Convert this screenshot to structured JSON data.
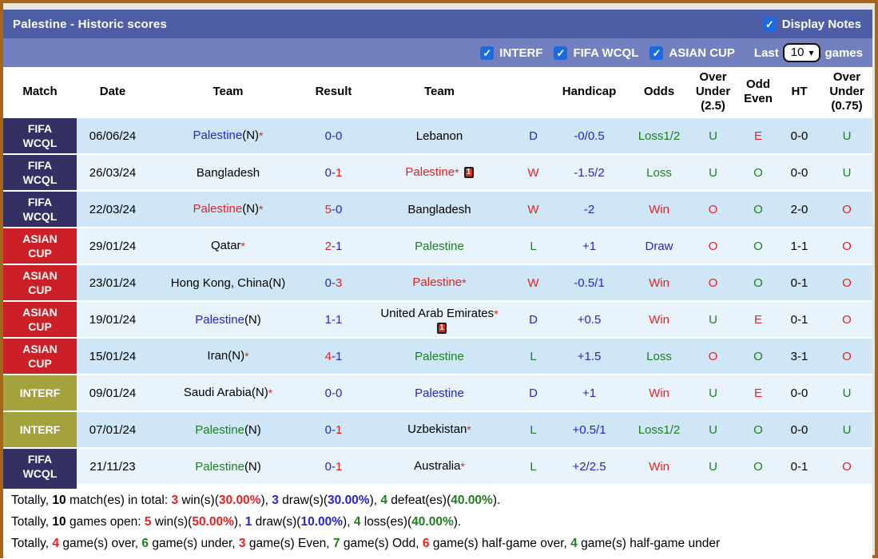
{
  "header": {
    "title": "Palestine - Historic scores",
    "display_notes_label": "Display Notes"
  },
  "filter_bar": {
    "checkboxes": [
      {
        "label": "INTERF",
        "checked": true
      },
      {
        "label": "FIFA WCQL",
        "checked": true
      },
      {
        "label": "ASIAN CUP",
        "checked": true
      }
    ],
    "last_label": "Last",
    "last_value": "10",
    "games_label": "games"
  },
  "table": {
    "columns": [
      "Match",
      "Date",
      "Team",
      "Result",
      "Team",
      "",
      "Handicap",
      "Odds",
      "Over Under (2.5)",
      "Odd Even",
      "HT",
      "Over Under (0.75)"
    ],
    "rows": [
      {
        "comp": "FIFA WCQL",
        "comp_key": "fifa",
        "date": "06/06/24",
        "home": {
          "name": "Palestine",
          "suffix": "(N)",
          "star": true,
          "color": "blue",
          "card": ""
        },
        "result": {
          "h": "0",
          "a": "0",
          "hc": "blue",
          "ac": "blue"
        },
        "away": {
          "name": "Lebanon",
          "suffix": "",
          "star": false,
          "color": "black",
          "card": ""
        },
        "wdl": {
          "t": "D",
          "c": "blue"
        },
        "handicap": "-0/0.5",
        "odds": {
          "t": "Loss1/2",
          "c": "green"
        },
        "ou25": {
          "t": "U",
          "c": "green"
        },
        "oddeven": {
          "t": "E",
          "c": "red"
        },
        "ht": "0-0",
        "ou075": {
          "t": "U",
          "c": "green"
        }
      },
      {
        "comp": "FIFA WCQL",
        "comp_key": "fifa",
        "date": "26/03/24",
        "home": {
          "name": "Bangladesh",
          "suffix": "",
          "star": false,
          "color": "black",
          "card": ""
        },
        "result": {
          "h": "0",
          "a": "1",
          "hc": "blue",
          "ac": "red"
        },
        "away": {
          "name": "Palestine",
          "suffix": "",
          "star": true,
          "color": "red",
          "card": "inline"
        },
        "wdl": {
          "t": "W",
          "c": "red"
        },
        "handicap": "-1.5/2",
        "odds": {
          "t": "Loss",
          "c": "green"
        },
        "ou25": {
          "t": "U",
          "c": "green"
        },
        "oddeven": {
          "t": "O",
          "c": "green"
        },
        "ht": "0-0",
        "ou075": {
          "t": "U",
          "c": "green"
        }
      },
      {
        "comp": "FIFA WCQL",
        "comp_key": "fifa",
        "date": "22/03/24",
        "home": {
          "name": "Palestine",
          "suffix": "(N)",
          "star": true,
          "color": "red",
          "card": ""
        },
        "result": {
          "h": "5",
          "a": "0",
          "hc": "red",
          "ac": "blue"
        },
        "away": {
          "name": "Bangladesh",
          "suffix": "",
          "star": false,
          "color": "black",
          "card": ""
        },
        "wdl": {
          "t": "W",
          "c": "red"
        },
        "handicap": "-2",
        "odds": {
          "t": "Win",
          "c": "red"
        },
        "ou25": {
          "t": "O",
          "c": "red"
        },
        "oddeven": {
          "t": "O",
          "c": "green"
        },
        "ht": "2-0",
        "ou075": {
          "t": "O",
          "c": "red"
        }
      },
      {
        "comp": "ASIAN CUP",
        "comp_key": "asian",
        "date": "29/01/24",
        "home": {
          "name": "Qatar",
          "suffix": "",
          "star": true,
          "color": "black",
          "card": ""
        },
        "result": {
          "h": "2",
          "a": "1",
          "hc": "red",
          "ac": "blue"
        },
        "away": {
          "name": "Palestine",
          "suffix": "",
          "star": false,
          "color": "green",
          "card": ""
        },
        "wdl": {
          "t": "L",
          "c": "green"
        },
        "handicap": "+1",
        "odds": {
          "t": "Draw",
          "c": "blue"
        },
        "ou25": {
          "t": "O",
          "c": "red"
        },
        "oddeven": {
          "t": "O",
          "c": "green"
        },
        "ht": "1-1",
        "ou075": {
          "t": "O",
          "c": "red"
        }
      },
      {
        "comp": "ASIAN CUP",
        "comp_key": "asian",
        "date": "23/01/24",
        "home": {
          "name": "Hong Kong, China",
          "suffix": "(N)",
          "star": false,
          "color": "black",
          "card": ""
        },
        "result": {
          "h": "0",
          "a": "3",
          "hc": "blue",
          "ac": "red"
        },
        "away": {
          "name": "Palestine",
          "suffix": "",
          "star": true,
          "color": "red",
          "card": ""
        },
        "wdl": {
          "t": "W",
          "c": "red"
        },
        "handicap": "-0.5/1",
        "odds": {
          "t": "Win",
          "c": "red"
        },
        "ou25": {
          "t": "O",
          "c": "red"
        },
        "oddeven": {
          "t": "O",
          "c": "green"
        },
        "ht": "0-1",
        "ou075": {
          "t": "O",
          "c": "red"
        }
      },
      {
        "comp": "ASIAN CUP",
        "comp_key": "asian",
        "date": "19/01/24",
        "home": {
          "name": "Palestine",
          "suffix": "(N)",
          "star": false,
          "color": "blue",
          "card": ""
        },
        "result": {
          "h": "1",
          "a": "1",
          "hc": "blue",
          "ac": "blue"
        },
        "away": {
          "name": "United Arab Emirates",
          "suffix": "",
          "star": true,
          "color": "black",
          "card": "below"
        },
        "wdl": {
          "t": "D",
          "c": "blue"
        },
        "handicap": "+0.5",
        "odds": {
          "t": "Win",
          "c": "red"
        },
        "ou25": {
          "t": "U",
          "c": "green"
        },
        "oddeven": {
          "t": "E",
          "c": "red"
        },
        "ht": "0-1",
        "ou075": {
          "t": "O",
          "c": "red"
        }
      },
      {
        "comp": "ASIAN CUP",
        "comp_key": "asian",
        "date": "15/01/24",
        "home": {
          "name": "Iran",
          "suffix": "(N)",
          "star": true,
          "color": "black",
          "card": ""
        },
        "result": {
          "h": "4",
          "a": "1",
          "hc": "red",
          "ac": "blue"
        },
        "away": {
          "name": "Palestine",
          "suffix": "",
          "star": false,
          "color": "green",
          "card": ""
        },
        "wdl": {
          "t": "L",
          "c": "green"
        },
        "handicap": "+1.5",
        "odds": {
          "t": "Loss",
          "c": "green"
        },
        "ou25": {
          "t": "O",
          "c": "red"
        },
        "oddeven": {
          "t": "O",
          "c": "green"
        },
        "ht": "3-1",
        "ou075": {
          "t": "O",
          "c": "red"
        }
      },
      {
        "comp": "INTERF",
        "comp_key": "interf",
        "date": "09/01/24",
        "home": {
          "name": "Saudi Arabia",
          "suffix": "(N)",
          "star": true,
          "color": "black",
          "card": ""
        },
        "result": {
          "h": "0",
          "a": "0",
          "hc": "blue",
          "ac": "blue"
        },
        "away": {
          "name": "Palestine",
          "suffix": "",
          "star": false,
          "color": "blue",
          "card": ""
        },
        "wdl": {
          "t": "D",
          "c": "blue"
        },
        "handicap": "+1",
        "odds": {
          "t": "Win",
          "c": "red"
        },
        "ou25": {
          "t": "U",
          "c": "green"
        },
        "oddeven": {
          "t": "E",
          "c": "red"
        },
        "ht": "0-0",
        "ou075": {
          "t": "U",
          "c": "green"
        }
      },
      {
        "comp": "INTERF",
        "comp_key": "interf",
        "date": "07/01/24",
        "home": {
          "name": "Palestine",
          "suffix": "(N)",
          "star": false,
          "color": "green",
          "card": ""
        },
        "result": {
          "h": "0",
          "a": "1",
          "hc": "blue",
          "ac": "red"
        },
        "away": {
          "name": "Uzbekistan",
          "suffix": "",
          "star": true,
          "color": "black",
          "card": ""
        },
        "wdl": {
          "t": "L",
          "c": "green"
        },
        "handicap": "+0.5/1",
        "odds": {
          "t": "Loss1/2",
          "c": "green"
        },
        "ou25": {
          "t": "U",
          "c": "green"
        },
        "oddeven": {
          "t": "O",
          "c": "green"
        },
        "ht": "0-0",
        "ou075": {
          "t": "U",
          "c": "green"
        }
      },
      {
        "comp": "FIFA WCQL",
        "comp_key": "fifa",
        "date": "21/11/23",
        "home": {
          "name": "Palestine",
          "suffix": "(N)",
          "star": false,
          "color": "green",
          "card": ""
        },
        "result": {
          "h": "0",
          "a": "1",
          "hc": "blue",
          "ac": "red"
        },
        "away": {
          "name": "Australia",
          "suffix": "",
          "star": true,
          "color": "black",
          "card": ""
        },
        "wdl": {
          "t": "L",
          "c": "green"
        },
        "handicap": "+2/2.5",
        "odds": {
          "t": "Win",
          "c": "red"
        },
        "ou25": {
          "t": "U",
          "c": "green"
        },
        "oddeven": {
          "t": "O",
          "c": "green"
        },
        "ht": "0-1",
        "ou075": {
          "t": "O",
          "c": "red"
        }
      }
    ]
  },
  "card_icon_label": "1",
  "footer": {
    "lines": [
      [
        {
          "text": "Totally, ",
          "color": "black",
          "bold": false
        },
        {
          "text": "10",
          "color": "black",
          "bold": true
        },
        {
          "text": " match(es) in total: ",
          "color": "black",
          "bold": false
        },
        {
          "text": "3",
          "color": "red",
          "bold": true
        },
        {
          "text": " win(s)(",
          "color": "black",
          "bold": false
        },
        {
          "text": "30.00%",
          "color": "red",
          "bold": true
        },
        {
          "text": "), ",
          "color": "black",
          "bold": false
        },
        {
          "text": "3",
          "color": "blue",
          "bold": true
        },
        {
          "text": " draw(s)(",
          "color": "black",
          "bold": false
        },
        {
          "text": "30.00%",
          "color": "blue",
          "bold": true
        },
        {
          "text": "), ",
          "color": "black",
          "bold": false
        },
        {
          "text": "4",
          "color": "green",
          "bold": true
        },
        {
          "text": " defeat(es)(",
          "color": "black",
          "bold": false
        },
        {
          "text": "40.00%",
          "color": "green",
          "bold": true
        },
        {
          "text": ").",
          "color": "black",
          "bold": false
        }
      ],
      [
        {
          "text": "Totally, ",
          "color": "black",
          "bold": false
        },
        {
          "text": "10",
          "color": "black",
          "bold": true
        },
        {
          "text": " games open: ",
          "color": "black",
          "bold": false
        },
        {
          "text": "5",
          "color": "red",
          "bold": true
        },
        {
          "text": " win(s)(",
          "color": "black",
          "bold": false
        },
        {
          "text": "50.00%",
          "color": "red",
          "bold": true
        },
        {
          "text": "), ",
          "color": "black",
          "bold": false
        },
        {
          "text": "1",
          "color": "blue",
          "bold": true
        },
        {
          "text": " draw(s)(",
          "color": "black",
          "bold": false
        },
        {
          "text": "10.00%",
          "color": "blue",
          "bold": true
        },
        {
          "text": "), ",
          "color": "black",
          "bold": false
        },
        {
          "text": "4",
          "color": "green",
          "bold": true
        },
        {
          "text": " loss(es)(",
          "color": "black",
          "bold": false
        },
        {
          "text": "40.00%",
          "color": "green",
          "bold": true
        },
        {
          "text": ").",
          "color": "black",
          "bold": false
        }
      ],
      [
        {
          "text": "Totally, ",
          "color": "black",
          "bold": false
        },
        {
          "text": "4",
          "color": "red",
          "bold": true
        },
        {
          "text": " game(s) over, ",
          "color": "black",
          "bold": false
        },
        {
          "text": "6",
          "color": "green",
          "bold": true
        },
        {
          "text": " game(s) under, ",
          "color": "black",
          "bold": false
        },
        {
          "text": "3",
          "color": "red",
          "bold": true
        },
        {
          "text": " game(s) Even, ",
          "color": "black",
          "bold": false
        },
        {
          "text": "7",
          "color": "green",
          "bold": true
        },
        {
          "text": " game(s) Odd, ",
          "color": "black",
          "bold": false
        },
        {
          "text": "6",
          "color": "red",
          "bold": true
        },
        {
          "text": " game(s) half-game over, ",
          "color": "black",
          "bold": false
        },
        {
          "text": "4",
          "color": "green",
          "bold": true
        },
        {
          "text": " game(s) half-game under",
          "color": "black",
          "bold": false
        }
      ]
    ]
  },
  "colors": {
    "blue": "#2525cd",
    "red": "#e82020",
    "green": "#1f7e1f",
    "black": "#111111",
    "bar1": "#4d5ea6",
    "bar2": "#7380bf",
    "fifa": "#333163",
    "asian": "#cb2027",
    "interf": "#a3a23c",
    "row_odd": "#cee6f5",
    "row_even": "#e9f3fb",
    "checkbox": "#1b6ae0",
    "border": "#a4661a",
    "page_bg": "#eae6da"
  }
}
